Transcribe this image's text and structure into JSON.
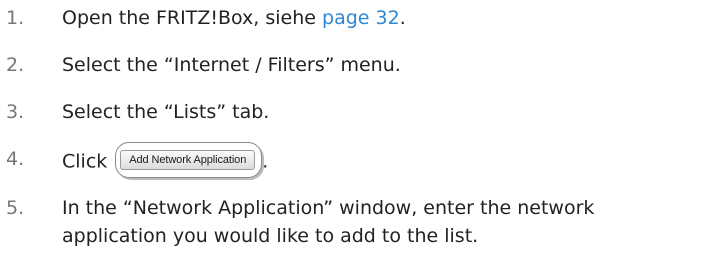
{
  "steps": [
    {
      "number": "1.",
      "text_before": "Open the FRITZ!Box, siehe ",
      "link": "page 32",
      "text_after": "."
    },
    {
      "number": "2.",
      "text": "Select the “Internet / Filters” menu."
    },
    {
      "number": "3.",
      "text": "Select the “Lists” tab."
    },
    {
      "number": "4.",
      "text_before": "Click",
      "button_label": "Add Network Application",
      "text_after": "."
    },
    {
      "number": "5.",
      "line1": "In the “Network Application” window, enter the network",
      "line2": "application you would like to add to the list."
    }
  ],
  "colors": {
    "number": "#777777",
    "text": "#222222",
    "link": "#2e87d6"
  }
}
